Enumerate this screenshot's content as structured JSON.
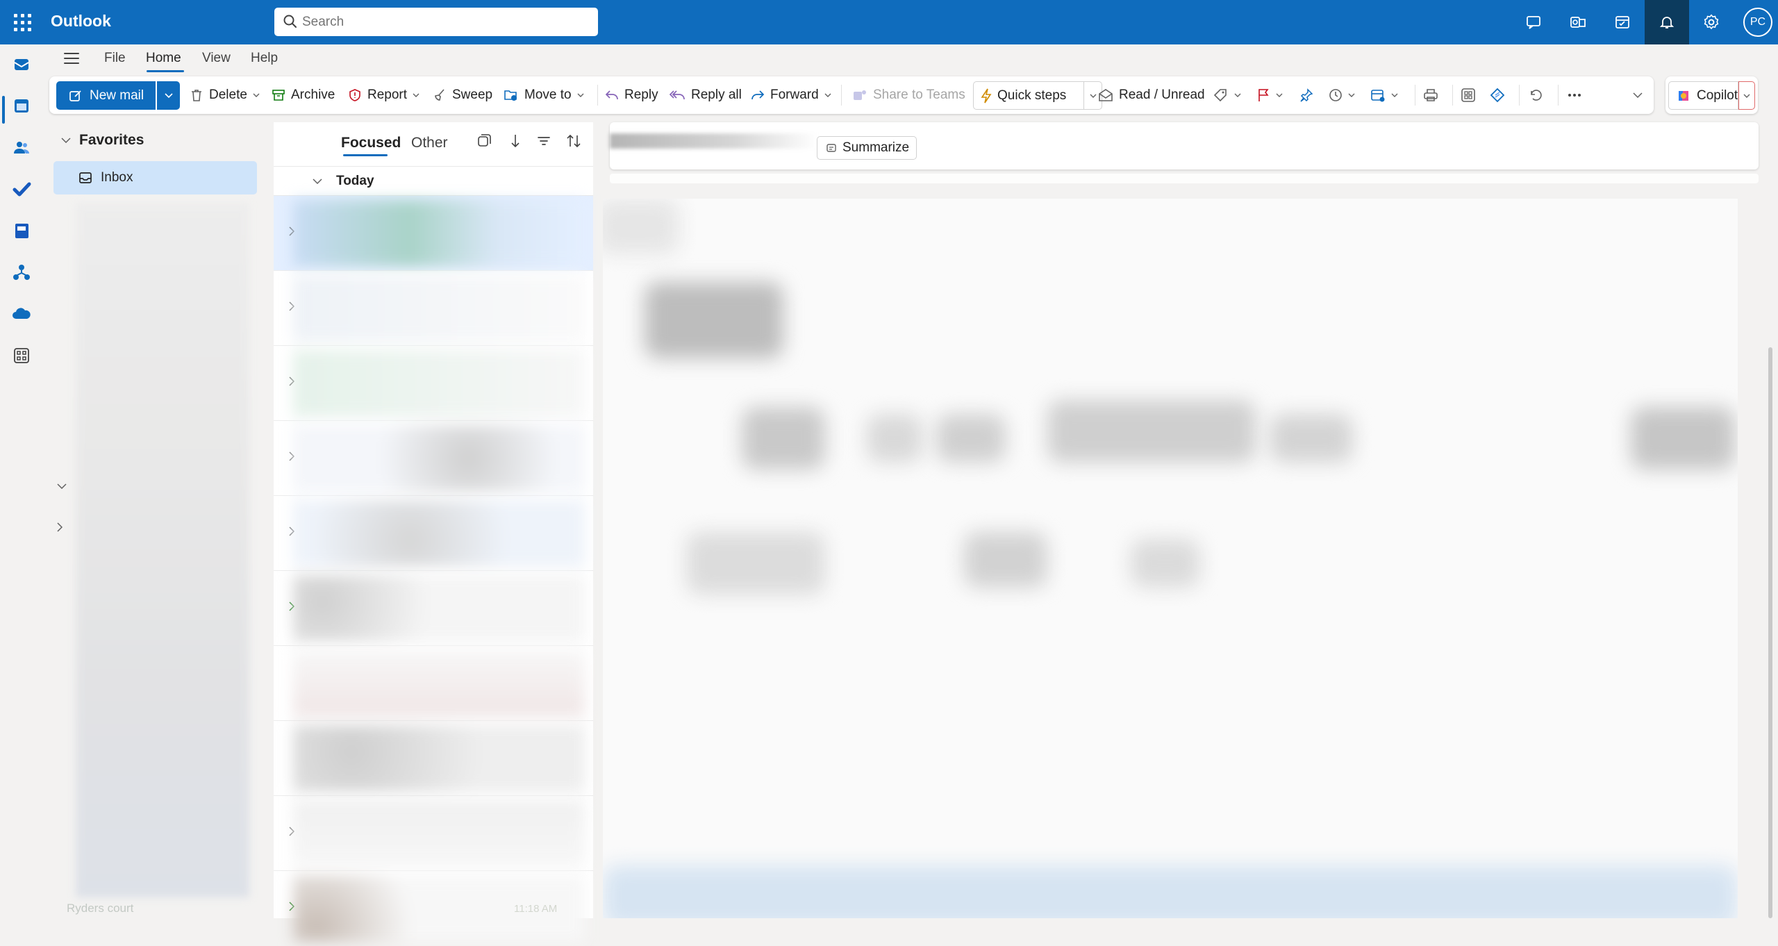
{
  "app": {
    "title": "Outlook",
    "avatar_initials": "PC"
  },
  "search": {
    "placeholder": "Search"
  },
  "menu": {
    "file": "File",
    "home": "Home",
    "view": "View",
    "help": "Help"
  },
  "ribbon": {
    "new_mail": "New mail",
    "delete": "Delete",
    "archive": "Archive",
    "report": "Report",
    "sweep": "Sweep",
    "move_to": "Move to",
    "reply": "Reply",
    "reply_all": "Reply all",
    "forward": "Forward",
    "share_to_teams": "Share to Teams",
    "quick_steps": "Quick steps",
    "read_unread": "Read / Unread",
    "copilot": "Copilot"
  },
  "folders": {
    "favorites": "Favorites",
    "inbox": "Inbox"
  },
  "list": {
    "tabs": {
      "focused": "Focused",
      "other": "Other"
    },
    "group_today": "Today",
    "last_sender": "Ryders court",
    "last_time": "11:18 AM"
  },
  "reading": {
    "summarize": "Summarize"
  },
  "colors": {
    "brand": "#0f6cbd",
    "selected": "#cfe4fa"
  }
}
